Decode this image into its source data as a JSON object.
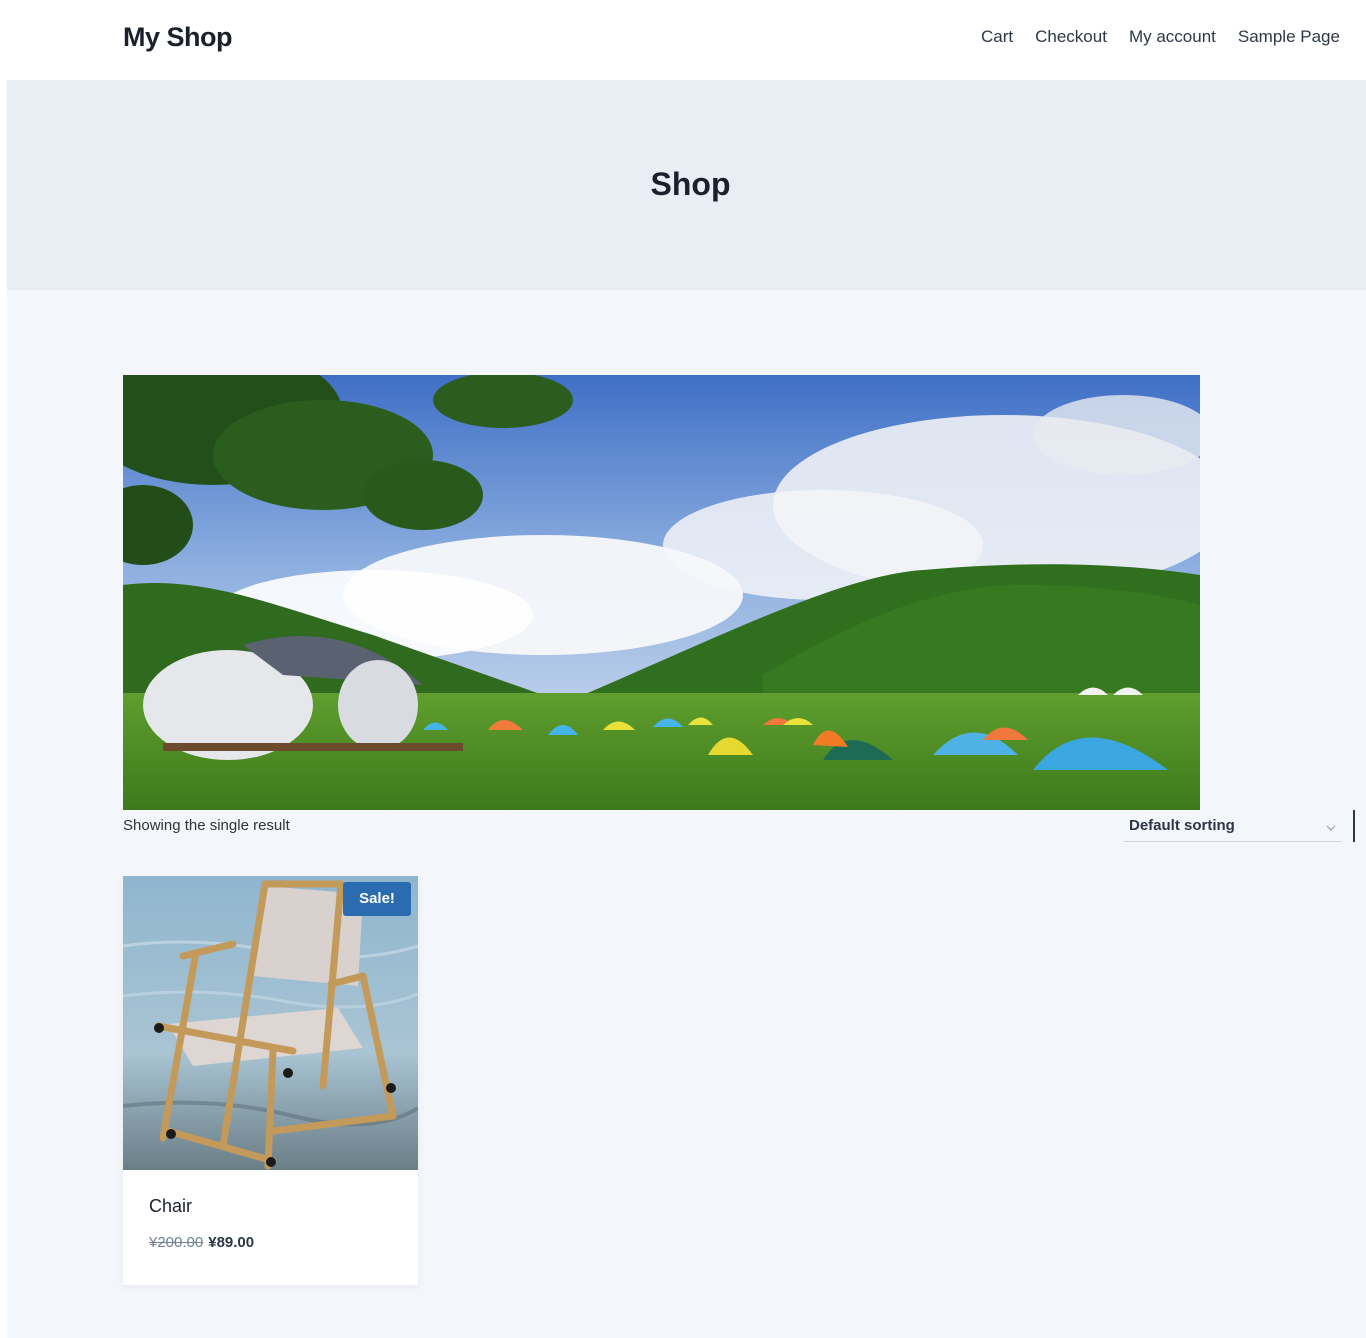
{
  "header": {
    "site_title": "My Shop",
    "nav": [
      "Cart",
      "Checkout",
      "My account",
      "Sample Page"
    ]
  },
  "hero": {
    "title": "Shop"
  },
  "toolbar": {
    "result_count": "Showing the single result",
    "sorting_selected": "Default sorting"
  },
  "products": [
    {
      "title": "Chair",
      "badge": "Sale!",
      "price_old": "¥200.00",
      "price_new": "¥89.00"
    }
  ],
  "colors": {
    "accent": "#2b6cb0",
    "hero_bg": "#e9eef5",
    "page_bg": "#f3f6fa"
  },
  "icons": {
    "sorting": "chevron-down-icon"
  }
}
